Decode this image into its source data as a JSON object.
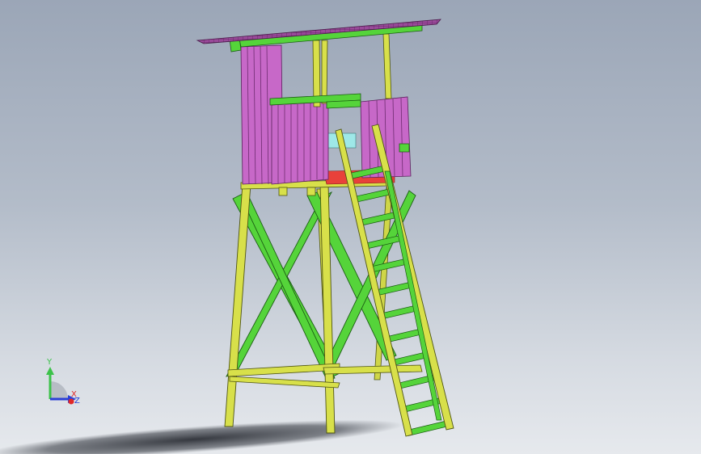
{
  "viewport": {
    "background_top": "#9ba6b7",
    "background_bottom": "#e6e9ed"
  },
  "model": {
    "colors": {
      "posts": "#d8e04a",
      "braces": "#55d43a",
      "walls": "#c768c8",
      "roof": "#8a3f8a",
      "floor": "#e8413a",
      "window": "#9ee8e8"
    },
    "ladder_rungs": 12
  },
  "triad": {
    "y_label": "Y",
    "x_label": "X",
    "z_label": "Z",
    "y_color": "#3cc24a",
    "x_color": "#e02828",
    "z_color": "#2a3fd6"
  }
}
